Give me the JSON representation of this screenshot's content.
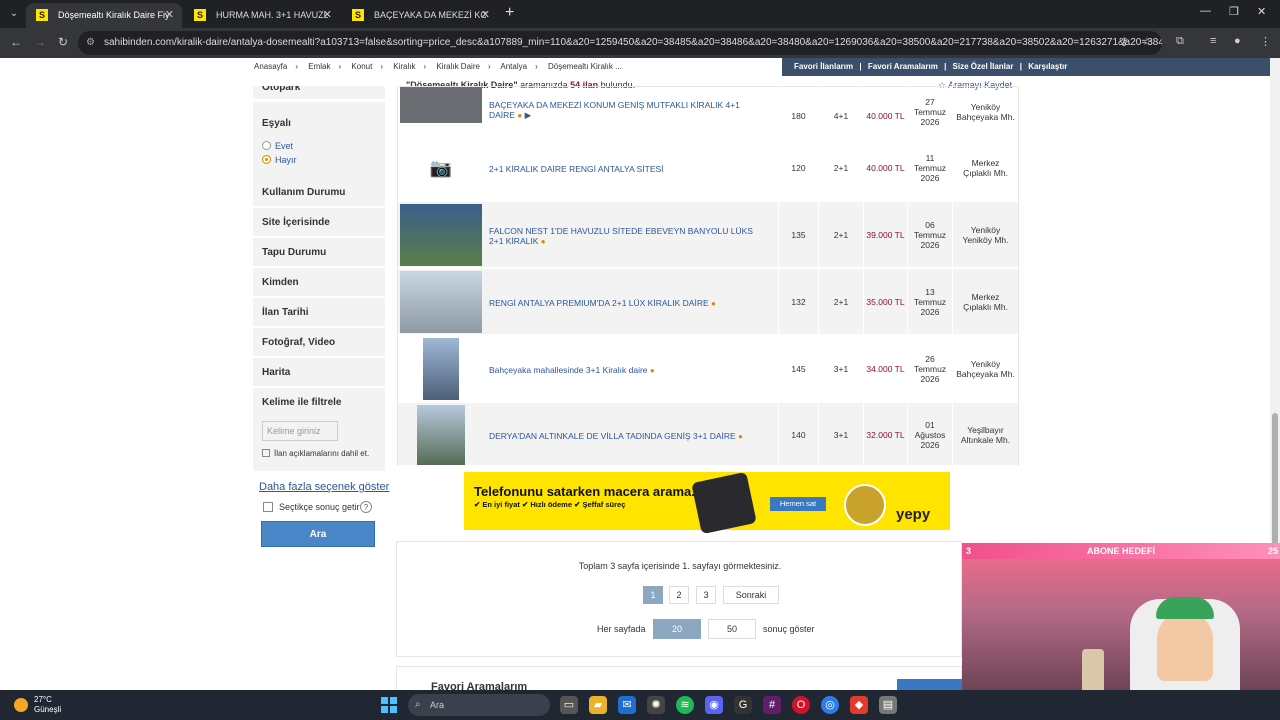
{
  "browser": {
    "tabs": [
      {
        "title": "Döşemealtı Kiralık Daire Fiyatları",
        "favicon": "S",
        "active": true
      },
      {
        "title": "HURMA MAH. 3+1 HAVUZLU SİTE",
        "favicon": "S",
        "active": false
      },
      {
        "title": "BAÇEYAKA DA MEKEZİ KONUM",
        "favicon": "S",
        "active": false
      }
    ],
    "url": "sahibinden.com/kiralik-daire/antalya-dosemealti?a103713=false&sorting=price_desc&a107889_min=110&a20=1259450&a20=38485&a20=38486&a20=38480&a20=1269036&a20=38500&a20=217738&a20=38502&a20=1263271&a20=384..."
  },
  "breadcrumb": [
    "Anasayfa",
    "Emlak",
    "Konut",
    "Kiralık",
    "Kiralık Daire",
    "Antalya",
    "Döşemealtı Kiralık ..."
  ],
  "top_links": [
    "Favori İlanlarım",
    "|",
    "Favori Aramalarım",
    "|",
    "Size Özel İlanlar",
    "|",
    "Karşılaştır"
  ],
  "result_summary": {
    "query": "\"Döşemealtı Kiralık Daire\"",
    "mid": " aramanızda ",
    "count": "54 ilan",
    "end": " bulundu."
  },
  "save_search": "☆ Aramayı Kaydet",
  "sidebar": {
    "cut_top": "Otopark",
    "furnished": {
      "label": "Eşyalı",
      "options": [
        {
          "label": "Evet",
          "selected": false
        },
        {
          "label": "Hayır",
          "selected": true
        }
      ]
    },
    "sections": [
      "Kullanım Durumu",
      "Site İçerisinde",
      "Tapu Durumu",
      "Kimden",
      "İlan Tarihi",
      "Fotoğraf, Video",
      "Harita"
    ],
    "keyword": {
      "label": "Kelime ile filtrele",
      "placeholder": "Kelime giriniz",
      "include_desc": "İlan açıklamalarını dahil et."
    },
    "more_link": "Daha fazla seçenek göster",
    "live_results": "Seçtikçe sonuç getir",
    "help": "?",
    "search_button": "Ara"
  },
  "listings": [
    {
      "title": "BAÇEYAKA DA MEKEZİ KONUM GENİŞ MUTFAKLI KİRALIK 4+1 DAİRE",
      "m2": "180",
      "rooms": "4+1",
      "price": "40.000 TL",
      "date_day": "27",
      "date_month": "Temmuz",
      "date_year": "2026",
      "loc1": "Yeniköy",
      "loc2": "Bahçeyaka Mh.",
      "has_photo": true
    },
    {
      "title": "2+1 KİRALIK DAİRE RENGİ ANTALYA SİTESİ",
      "m2": "120",
      "rooms": "2+1",
      "price": "40.000 TL",
      "date_day": "11",
      "date_month": "Temmuz",
      "date_year": "2026",
      "loc1": "Merkez",
      "loc2": "Çıplaklı Mh.",
      "has_photo": false
    },
    {
      "title": "FALCON NEST 1'DE HAVUZLU SİTEDE EBEVEYN BANYOLU LÜKS 2+1 KİRALIK",
      "m2": "135",
      "rooms": "2+1",
      "price": "39.000 TL",
      "date_day": "06",
      "date_month": "Temmuz",
      "date_year": "2026",
      "loc1": "Yeniköy",
      "loc2": "Yeniköy Mh.",
      "has_photo": true
    },
    {
      "title": "RENGİ ANTALYA PREMIUM'DA 2+1 LÜX KİRALIK DAİRE",
      "m2": "132",
      "rooms": "2+1",
      "price": "35.000 TL",
      "date_day": "13",
      "date_month": "Temmuz",
      "date_year": "2026",
      "loc1": "Merkez",
      "loc2": "Çıplaklı Mh.",
      "has_photo": true
    },
    {
      "title": "Bahçeyaka mahallesinde 3+1 Kiralık daire",
      "m2": "145",
      "rooms": "3+1",
      "price": "34.000 TL",
      "date_day": "26",
      "date_month": "Temmuz",
      "date_year": "2026",
      "loc1": "Yeniköy",
      "loc2": "Bahçeyaka Mh.",
      "has_photo": true
    },
    {
      "title": "DERYA'DAN ALTINKALE DE VİLLA TADINDA GENİŞ 3+1 DAİRE",
      "m2": "140",
      "rooms": "3+1",
      "price": "32.000 TL",
      "date_day": "01",
      "date_month": "Ağustos",
      "date_year": "2026",
      "loc1": "Yeşilbayır",
      "loc2": "Altınkale Mh.",
      "has_photo": true
    }
  ],
  "ad": {
    "headline": "Telefonunu satarken macera arama.",
    "points": "✔ En iyi fiyat   ✔ Hızlı ödeme   ✔ Şeffaf süreç",
    "cta": "Hemen sat",
    "brand": "yepy"
  },
  "pagination": {
    "summary": "Toplam 3 sayfa içerisinde 1. sayfayı görmektesiniz.",
    "pages": [
      "1",
      "2",
      "3"
    ],
    "current_page": "1",
    "next": "Sonraki",
    "per_page_label": "Her sayfada",
    "per_page_options": [
      "20",
      "50"
    ],
    "per_page_selected": "20",
    "per_page_suffix": "sonuç göster"
  },
  "favorite_searches_title": "Favori Aramalarım",
  "stream_overlay": {
    "left": "3",
    "title": "ABONE HEDEFİ",
    "right": "25"
  },
  "taskbar": {
    "temp": "27°C",
    "condition": "Güneşli",
    "search_placeholder": "Ara",
    "icons": [
      "file-explorer-icon",
      "task-view-icon",
      "folder-icon",
      "outlook-icon",
      "chatgpt-icon",
      "spotify-icon",
      "discord-icon",
      "cursor-app-icon",
      "slack-icon",
      "opera-icon",
      "chrome-icon",
      "anydesk-icon",
      "app-icon"
    ]
  },
  "colors": {
    "link": "#2c5699",
    "price": "#8a1526",
    "accent": "#ffe400",
    "header_bar": "#3c4f6a",
    "button": "#4a86c8"
  }
}
